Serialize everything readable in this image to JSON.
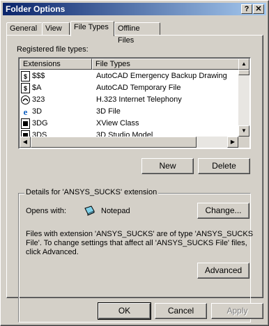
{
  "window": {
    "title": "Folder Options",
    "help_glyph": "?",
    "close_glyph": "✕"
  },
  "tabs": [
    {
      "label": "General"
    },
    {
      "label": "View"
    },
    {
      "label": "File Types"
    },
    {
      "label": "Offline Files"
    }
  ],
  "registered": {
    "label": "Registered file types:",
    "columns": {
      "extensions": "Extensions",
      "file_types": "File Types"
    },
    "rows": [
      {
        "ext": "$$$",
        "type": "AutoCAD Emergency Backup Drawing",
        "icon": "dollar-doc-icon"
      },
      {
        "ext": "$A",
        "type": "AutoCAD Temporary File",
        "icon": "dollar-doc-icon"
      },
      {
        "ext": "323",
        "type": "H.323 Internet Telephony",
        "icon": "telephony-icon"
      },
      {
        "ext": "3D",
        "type": "3D File",
        "icon": "ie-icon"
      },
      {
        "ext": "3DG",
        "type": "XView Class",
        "icon": "xview-icon"
      },
      {
        "ext": "3DS",
        "type": "3D Studio Model",
        "icon": "xview-icon"
      }
    ]
  },
  "buttons": {
    "new": "New",
    "delete": "Delete",
    "change": "Change...",
    "advanced": "Advanced",
    "ok": "OK",
    "cancel": "Cancel",
    "apply": "Apply"
  },
  "details": {
    "title": "Details for 'ANSYS_SUCKS' extension",
    "opens_with_label": "Opens with:",
    "opens_with_app": "Notepad",
    "desc_line1": "Files with extension 'ANSYS_SUCKS' are of type 'ANSYS_SUCKS",
    "desc_line2": "File'.  To change settings that affect all 'ANSYS_SUCKS File' files,",
    "desc_line3": "click Advanced."
  }
}
